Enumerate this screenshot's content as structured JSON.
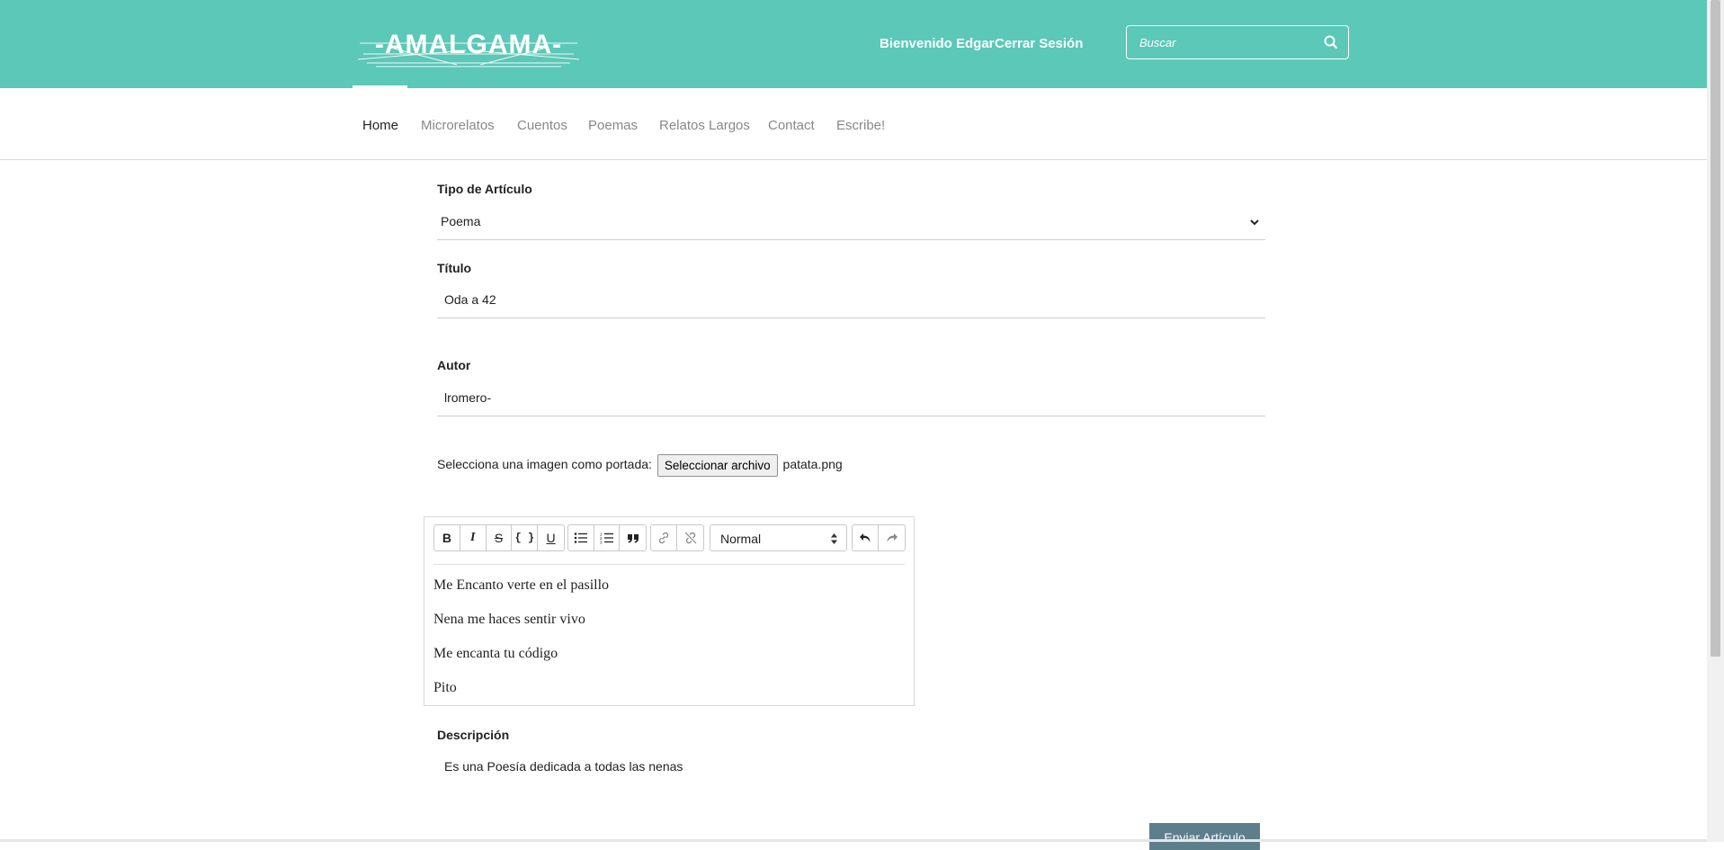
{
  "header": {
    "logo_text": "-AMALGAMA-",
    "welcome": "Bienvenido Edgar",
    "logout": "Cerrar Sesión",
    "search_placeholder": "Buscar",
    "search_icon": "search-icon"
  },
  "nav": {
    "items": [
      {
        "label": "Home",
        "active": true
      },
      {
        "label": "Microrelatos",
        "active": false
      },
      {
        "label": "Cuentos",
        "active": false
      },
      {
        "label": "Poemas",
        "active": false
      },
      {
        "label": "Relatos Largos",
        "active": false
      },
      {
        "label": "Contact",
        "active": false
      },
      {
        "label": "Escribe!",
        "active": false
      }
    ]
  },
  "form": {
    "type_label": "Tipo de Artículo",
    "type_value": "Poema",
    "title_label": "Título",
    "title_value": "Oda a 42",
    "author_label": "Autor",
    "author_value": "lromero-",
    "upload_label": "Selecciona una imagen como portada:",
    "upload_button": "Seleccionar archivo",
    "upload_filename": "patata.png",
    "description_label": "Descripción",
    "description_value": "Es una Poesía dedicada a todas las nenas",
    "submit_label": "Enviar Artículo"
  },
  "editor": {
    "toolbar": {
      "bold": "B",
      "italic": "I",
      "strike": "S",
      "code": "{ }",
      "underline": "U",
      "heading_value": "Normal"
    },
    "lines": [
      "Me Encanto verte en el pasillo",
      "Nena me haces sentir vivo",
      "Me encanta tu código",
      "Pito"
    ]
  },
  "colors": {
    "header_bg": "#5bc8b8",
    "submit_bg": "#5d7f8c"
  }
}
